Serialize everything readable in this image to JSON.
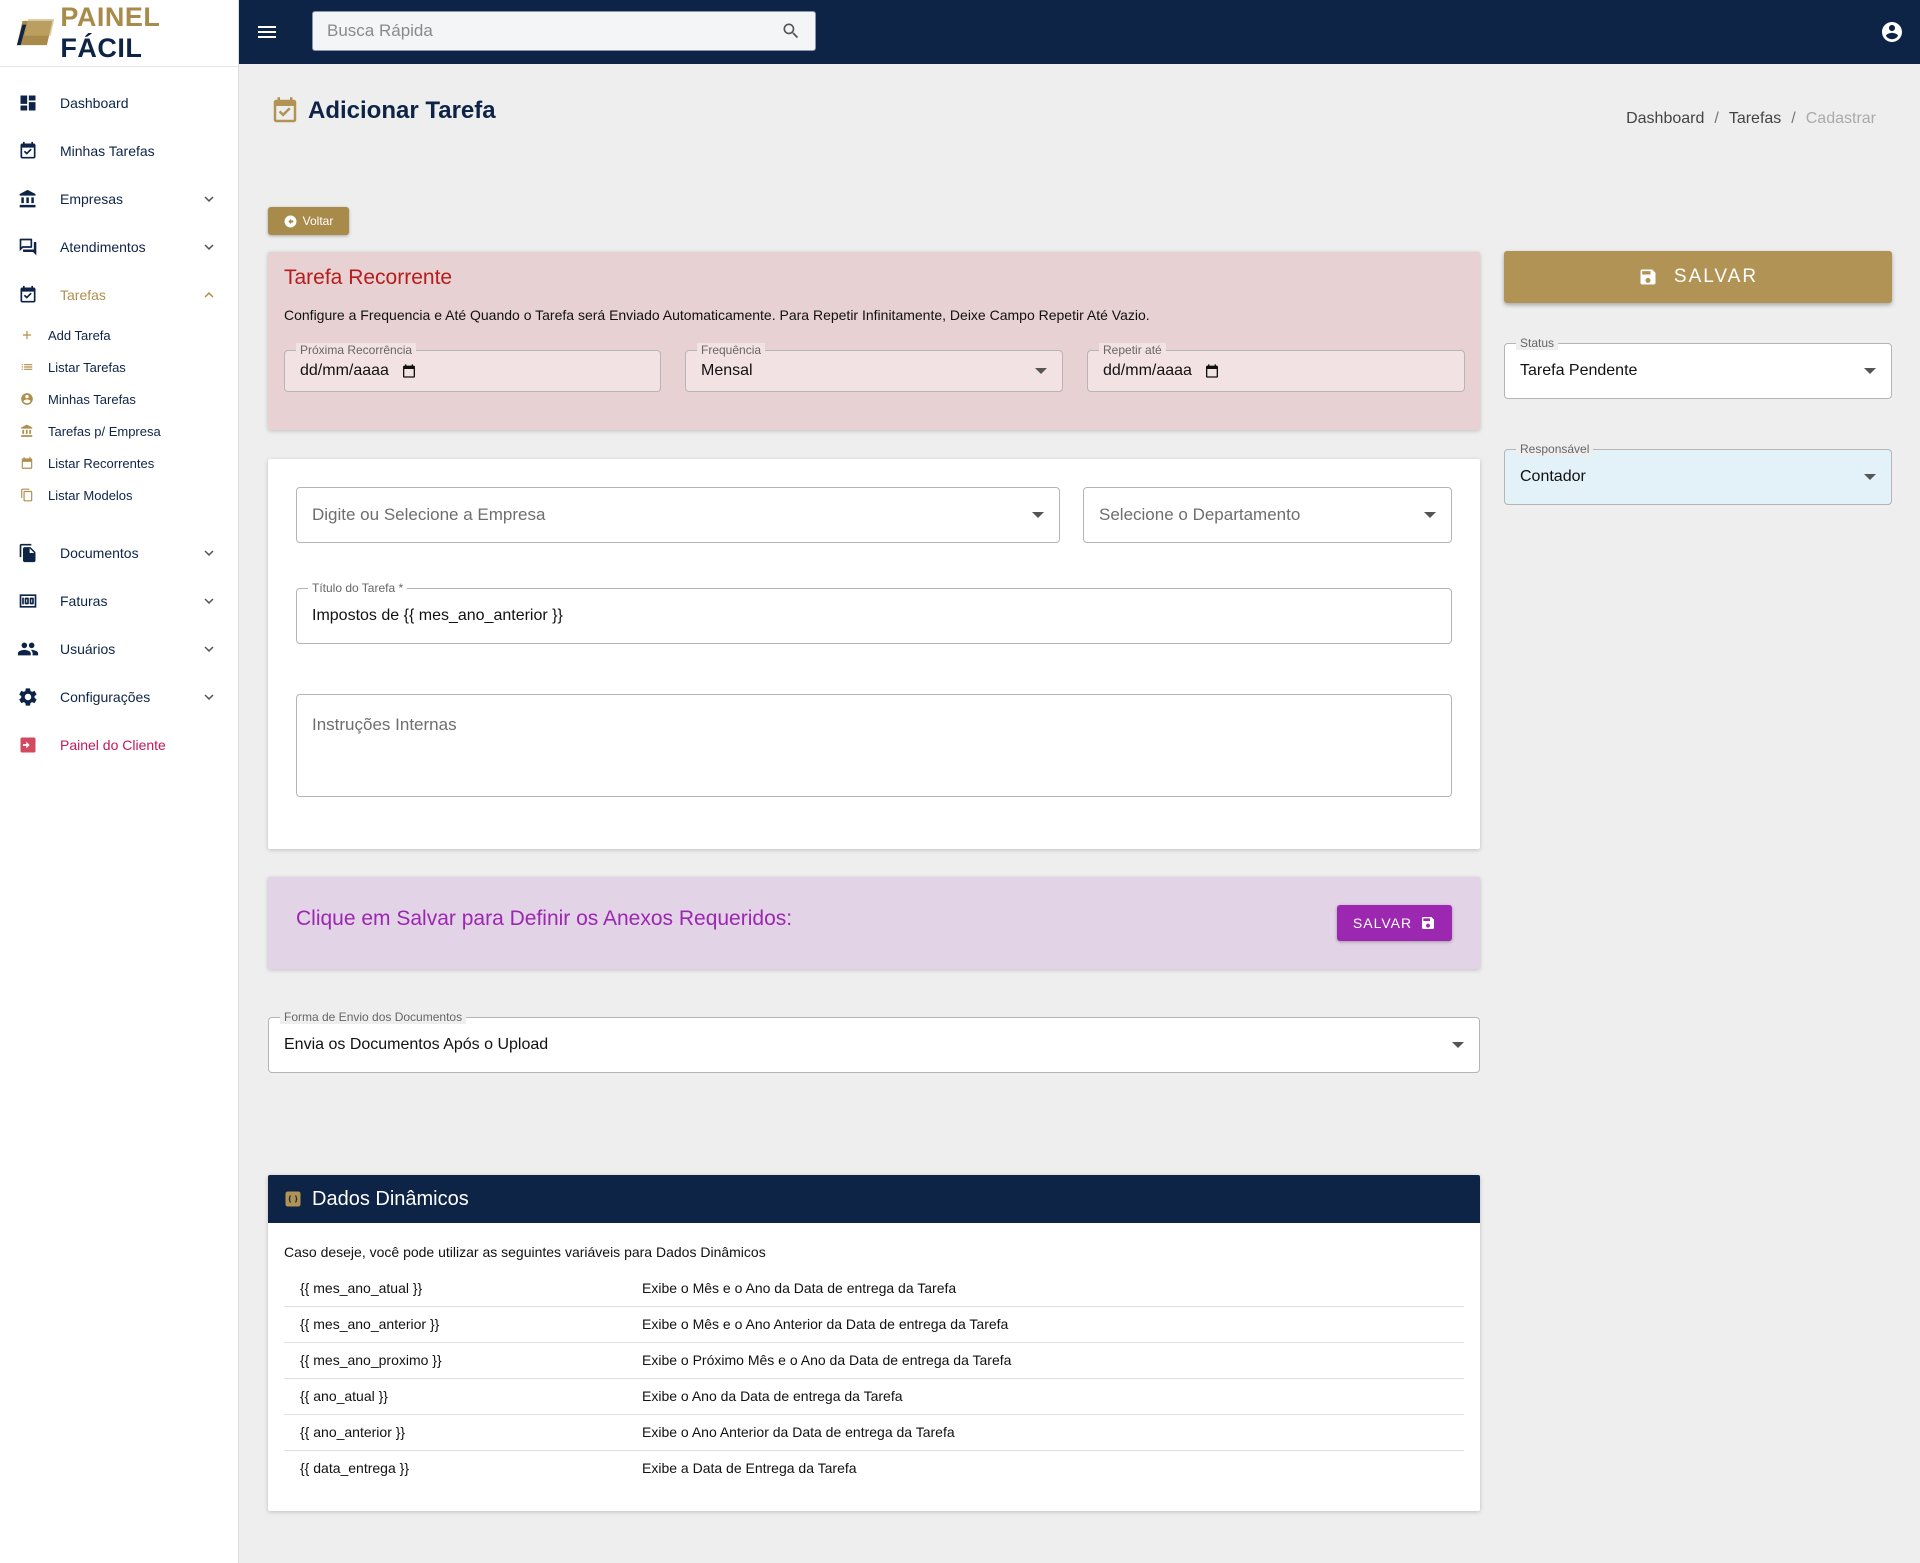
{
  "brand": {
    "part1": "PAINEL",
    "part2": "FÁCIL"
  },
  "search": {
    "placeholder": "Busca Rápida"
  },
  "sidebar": {
    "items": [
      {
        "label": "Dashboard",
        "icon": "dashboard-icon"
      },
      {
        "label": "Minhas Tarefas",
        "icon": "calendar-check-icon"
      },
      {
        "label": "Empresas",
        "icon": "bank-icon"
      },
      {
        "label": "Atendimentos",
        "icon": "chat-icon"
      },
      {
        "label": "Tarefas",
        "icon": "calendar-check-icon"
      },
      {
        "label": "Documentos",
        "icon": "documents-icon"
      },
      {
        "label": "Faturas",
        "icon": "money-icon"
      },
      {
        "label": "Usuários",
        "icon": "people-icon"
      },
      {
        "label": "Configurações",
        "icon": "gear-icon"
      },
      {
        "label": "Painel do Cliente",
        "icon": "exit-icon"
      }
    ],
    "sub_items": [
      {
        "label": "Add Tarefa",
        "icon": "plus-icon"
      },
      {
        "label": "Listar Tarefas",
        "icon": "list-icon"
      },
      {
        "label": "Minhas Tarefas",
        "icon": "account-circle-icon"
      },
      {
        "label": "Tarefas p/ Empresa",
        "icon": "bank-icon"
      },
      {
        "label": "Listar Recorrentes",
        "icon": "repeat-icon"
      },
      {
        "label": "Listar Modelos",
        "icon": "copy-icon"
      }
    ]
  },
  "header": {
    "title": "Adicionar Tarefa",
    "breadcrumb": [
      "Dashboard",
      "Tarefas",
      "Cadastrar"
    ],
    "breadcrumb_sep": "/"
  },
  "back_button": "Voltar",
  "recurrence": {
    "title": "Tarefa Recorrente",
    "description": "Configure a Frequencia e Até Quando o Tarefa será Enviado Automaticamente. Para Repetir Infinitamente, Deixe Campo Repetir Até Vazio.",
    "next_label": "Próxima Recorrência",
    "next_value": "dd/mm/aaaa",
    "freq_label": "Frequência",
    "freq_value": "Mensal",
    "until_label": "Repetir até",
    "until_value": "dd/mm/aaaa"
  },
  "form": {
    "company_placeholder": "Digite ou Selecione a Empresa",
    "department_placeholder": "Selecione o Departamento",
    "title_label": "Título do Tarefa *",
    "title_value": "Impostos de {{ mes_ano_anterior }}",
    "instructions_placeholder": "Instruções Internas"
  },
  "attachments": {
    "text": "Clique em Salvar para Definir os Anexos Requeridos:",
    "button": "SALVAR"
  },
  "delivery": {
    "label": "Forma de Envio dos Documentos",
    "value": "Envia os Documentos Após o Upload"
  },
  "dynamic": {
    "title": "Dados Dinâmicos",
    "intro": "Caso deseje, você pode utilizar as seguintes variáveis para Dados Dinâmicos",
    "rows": [
      {
        "var": "{{ mes_ano_atual }}",
        "desc": "Exibe o Mês e o Ano da Data de entrega da Tarefa"
      },
      {
        "var": "{{ mes_ano_anterior }}",
        "desc": "Exibe o Mês e o Ano Anterior da Data de entrega da Tarefa"
      },
      {
        "var": "{{ mes_ano_proximo }}",
        "desc": "Exibe o Próximo Mês e o Ano da Data de entrega da Tarefa"
      },
      {
        "var": "{{ ano_atual }}",
        "desc": "Exibe o Ano da Data de entrega da Tarefa"
      },
      {
        "var": "{{ ano_anterior }}",
        "desc": "Exibe o Ano Anterior da Data de entrega da Tarefa"
      },
      {
        "var": "{{ data_entrega }}",
        "desc": "Exibe a Data de Entrega da Tarefa"
      }
    ]
  },
  "right": {
    "save_button": "SALVAR",
    "status_label": "Status",
    "status_value": "Tarefa Pendente",
    "resp_label": "Responsável",
    "resp_value": "Contador"
  },
  "colors": {
    "navy": "#0d2447",
    "gold": "#b09355",
    "purple": "#9c27b0",
    "red": "#b71c1c",
    "client_red": "#c2185b"
  }
}
